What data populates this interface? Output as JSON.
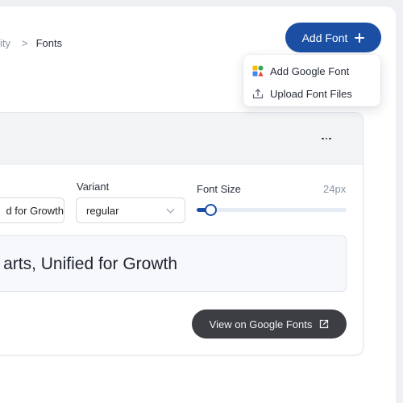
{
  "breadcrumb": {
    "previous": "ity",
    "separator": ">",
    "current": "Fonts"
  },
  "header": {
    "add_font_label": "Add Font"
  },
  "add_menu": {
    "items": [
      {
        "label": "Add Google Font",
        "icon": "google-fonts-icon"
      },
      {
        "label": "Upload Font Files",
        "icon": "upload-icon"
      }
    ]
  },
  "font_card": {
    "more_icon": "more-horizontal-icon",
    "name_value": "d for Growth",
    "variant": {
      "label": "Variant",
      "value": "regular"
    },
    "font_size": {
      "label": "Font Size",
      "value_text": "24px",
      "level": 0.09
    },
    "preview_text": "arts, Unified for Growth",
    "view_button_label": "View on Google Fonts"
  },
  "colors": {
    "primary": "#1a4fa3",
    "dark_button": "#3c3e43",
    "muted_text": "#8a93a6"
  }
}
